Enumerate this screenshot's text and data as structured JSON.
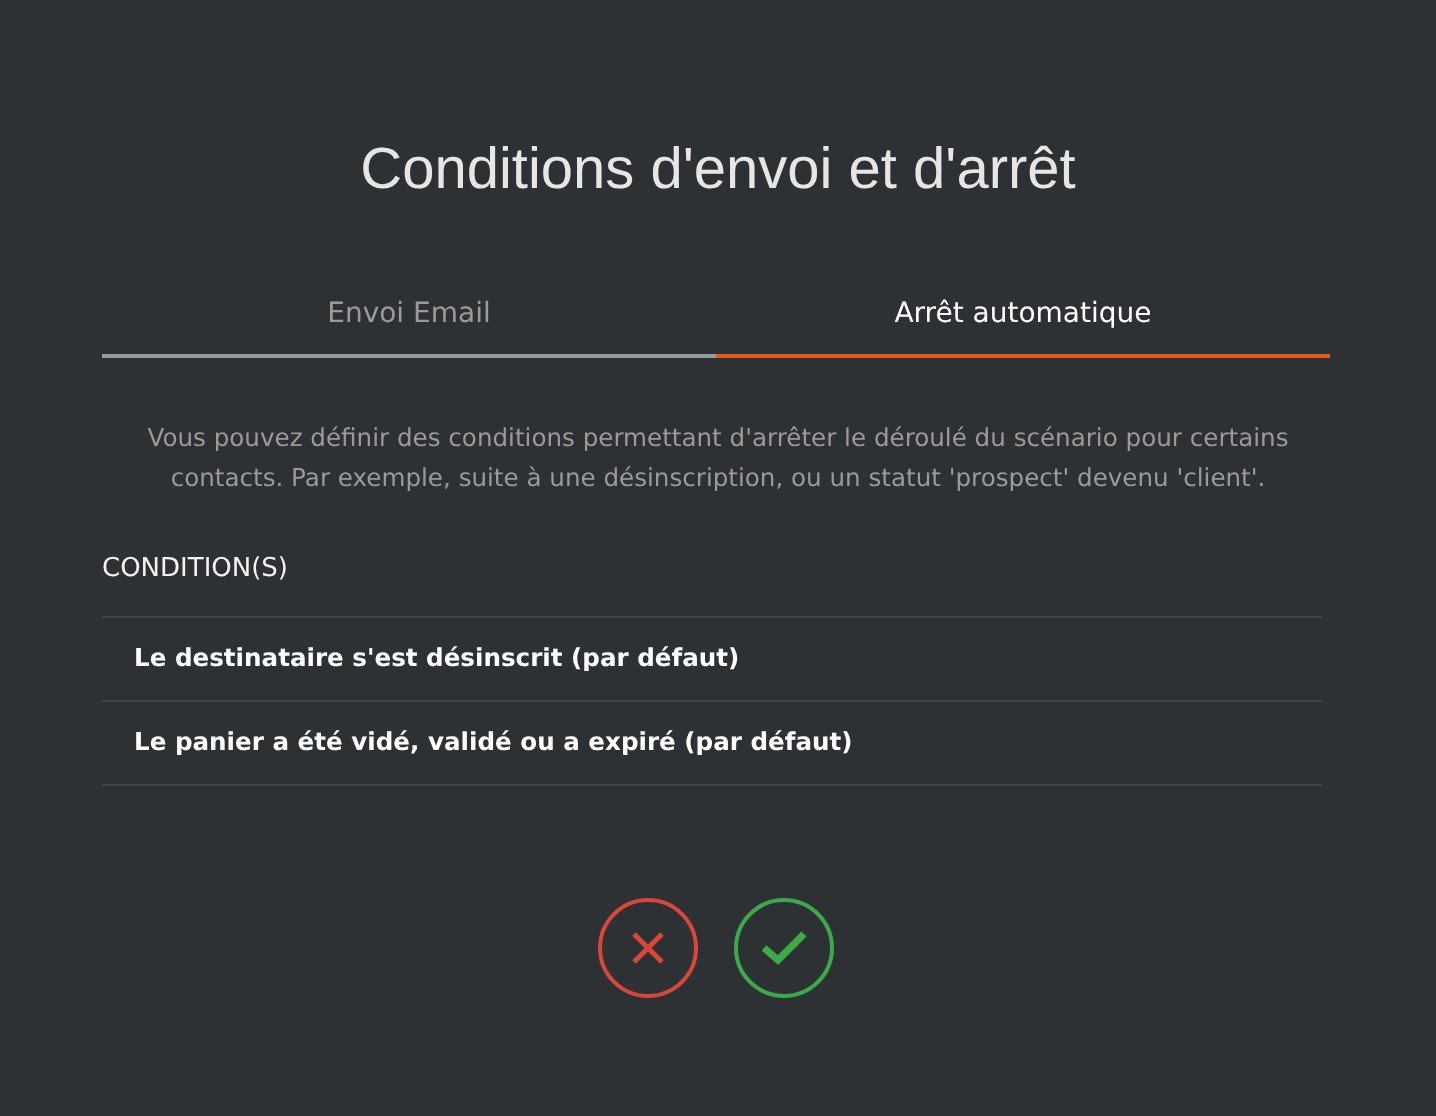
{
  "title": "Conditions d'envoi et d'arrêt",
  "tabs": [
    {
      "label": "Envoi Email",
      "selected": false
    },
    {
      "label": "Arrêt automatique",
      "selected": true
    }
  ],
  "description": "Vous pouvez définir des conditions permettant d'arrêter le déroulé du scénario pour certains contacts. Par exemple, suite à une désinscription, ou un statut 'prospect' devenu 'client'.",
  "conditions": {
    "heading": "CONDITION(S)",
    "items": [
      "Le destinataire s'est désinscrit (par défaut)",
      "Le panier a été vidé, validé ou a expiré (par défaut)"
    ]
  }
}
